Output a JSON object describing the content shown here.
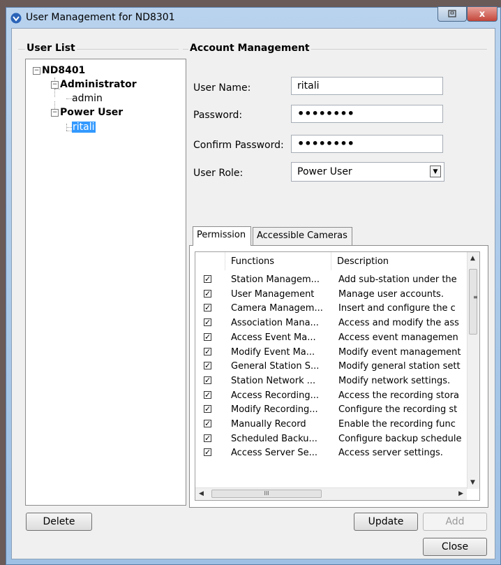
{
  "window": {
    "title": "User Management for ND8301",
    "close_glyph": "x"
  },
  "user_list": {
    "title": "User List",
    "root": "ND8401",
    "groups": [
      {
        "name": "Administrator",
        "users": [
          "admin"
        ]
      },
      {
        "name": "Power User",
        "users": [
          "ritali"
        ]
      }
    ],
    "selected_user": "ritali",
    "delete_label": "Delete"
  },
  "account": {
    "title": "Account Management",
    "username_label": "User Name:",
    "username_value": "ritali",
    "password_label": "Password:",
    "password_value": "••••••••",
    "confirm_label": "Confirm Password:",
    "confirm_value": "••••••••",
    "role_label": "User Role:",
    "role_value": "Power User"
  },
  "tabs": {
    "permission": "Permission",
    "cameras": "Accessible Cameras",
    "active": "Permission"
  },
  "permissions": {
    "headers": {
      "functions": "Functions",
      "description": "Description"
    },
    "rows": [
      {
        "checked": true,
        "function": "Station Managem...",
        "description": "Add sub-station under the"
      },
      {
        "checked": true,
        "function": "User Management",
        "description": "Manage user accounts."
      },
      {
        "checked": true,
        "function": "Camera Managem...",
        "description": "Insert and configure the c"
      },
      {
        "checked": true,
        "function": "Association Mana...",
        "description": "Access and modify the ass"
      },
      {
        "checked": true,
        "function": "Access Event Ma...",
        "description": "Access event managemen"
      },
      {
        "checked": true,
        "function": "Modify Event Ma...",
        "description": "Modify event management"
      },
      {
        "checked": true,
        "function": "General Station S...",
        "description": "Modify general station sett"
      },
      {
        "checked": true,
        "function": "Station Network ...",
        "description": "Modify network settings."
      },
      {
        "checked": true,
        "function": "Access Recording...",
        "description": "Access the recording stora"
      },
      {
        "checked": true,
        "function": "Modify Recording...",
        "description": "Configure the recording st"
      },
      {
        "checked": true,
        "function": "Manually Record",
        "description": "Enable the recording func"
      },
      {
        "checked": true,
        "function": "Scheduled Backu...",
        "description": "Configure backup schedule"
      },
      {
        "checked": true,
        "function": "Access Server Se...",
        "description": "Access server settings."
      }
    ],
    "check_glyph": "✓",
    "hscroll_grip": "III"
  },
  "buttons": {
    "update": "Update",
    "add": "Add",
    "close": "Close"
  }
}
